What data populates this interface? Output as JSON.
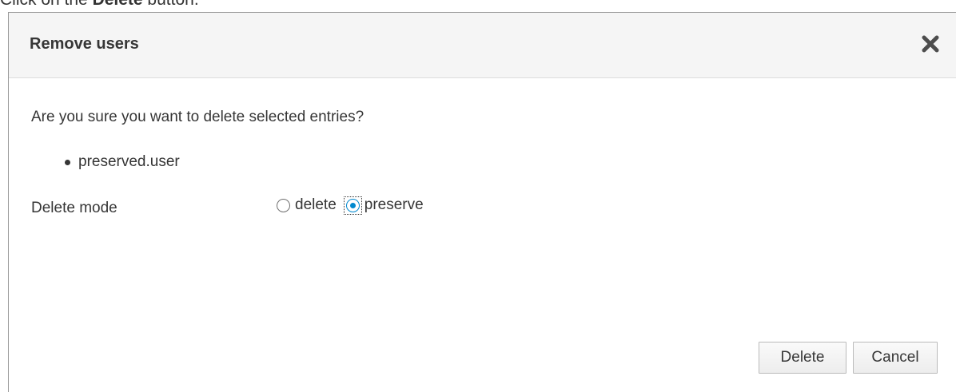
{
  "instruction": {
    "prefix": "Click on the ",
    "emphasis": "Delete",
    "suffix": " button."
  },
  "dialog": {
    "title": "Remove users",
    "close_icon": "close-icon",
    "question": "Are you sure you want to delete selected entries?",
    "entries": [
      "preserved.user"
    ],
    "delete_mode": {
      "label": "Delete mode",
      "options": [
        {
          "label": "delete",
          "selected": false
        },
        {
          "label": "preserve",
          "selected": true
        }
      ]
    },
    "buttons": {
      "delete_label": "Delete",
      "cancel_label": "Cancel"
    }
  },
  "colors": {
    "accent": "#0088ce",
    "header_bg": "#f5f5f5",
    "text": "#363636"
  }
}
